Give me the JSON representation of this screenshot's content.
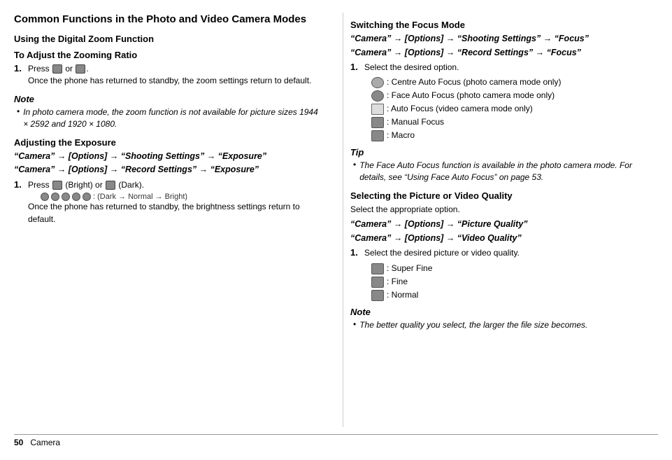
{
  "page": {
    "footer_page_number": "50",
    "footer_label": "Camera"
  },
  "left_column": {
    "main_title": "Common Functions in the Photo and Video Camera Modes",
    "digital_zoom": {
      "section_title": "Using the Digital Zoom Function",
      "subsection": "To Adjust the Zooming Ratio",
      "step1_num": "1.",
      "step1_text_part1": "Press",
      "step1_text_icons": "or",
      "step1_continuation": "Once the phone has returned to standby, the zoom settings return to default.",
      "note_title": "Note",
      "note_bullet": "In photo camera mode, the zoom function is not available for picture sizes 1944 × 2592 and 1920 × 1080."
    },
    "exposure": {
      "section_title": "Adjusting the Exposure",
      "path1": "“Camera” → [Options] → “Shooting Settings” → “Exposure”",
      "path2": "“Camera” → [Options] → “Record Settings” → “Exposure”",
      "step1_num": "1.",
      "step1_text": "(Bright) or",
      "step1_text2": "(Dark).",
      "exposure_label": ": (Dark → Normal → Bright)",
      "continuation": "Once the phone has returned to standby, the brightness settings return to default."
    }
  },
  "right_column": {
    "focus_mode": {
      "section_title": "Switching the Focus Mode",
      "path1": "“Camera” → [Options] → “Shooting Settings” → “Focus”",
      "path2": "“Camera” → [Options] → “Record Settings” → “Focus”",
      "step1_num": "1.",
      "step1_text": "Select the desired option.",
      "options": [
        ": Centre Auto Focus (photo camera mode only)",
        ": Face Auto Focus (photo camera mode only)",
        ": Auto Focus (video camera mode only)",
        ": Manual Focus",
        ": Macro"
      ]
    },
    "tip": {
      "tip_title": "Tip",
      "tip_bullet": "The Face Auto Focus function is available in the photo camera mode. For details, see “Using Face Auto Focus” on page 53."
    },
    "picture_quality": {
      "section_title": "Selecting the Picture or Video Quality",
      "intro_text": "Select the appropriate option.",
      "path1": "“Camera” → [Options] → “Picture Quality”",
      "path2": "“Camera” → [Options] → “Video Quality”",
      "step1_num": "1.",
      "step1_text": "Select the desired picture or video quality.",
      "options": [
        ": Super Fine",
        ": Fine",
        ": Normal"
      ]
    },
    "note": {
      "note_title": "Note",
      "note_bullet": "The better quality you select, the larger the file size becomes."
    }
  }
}
